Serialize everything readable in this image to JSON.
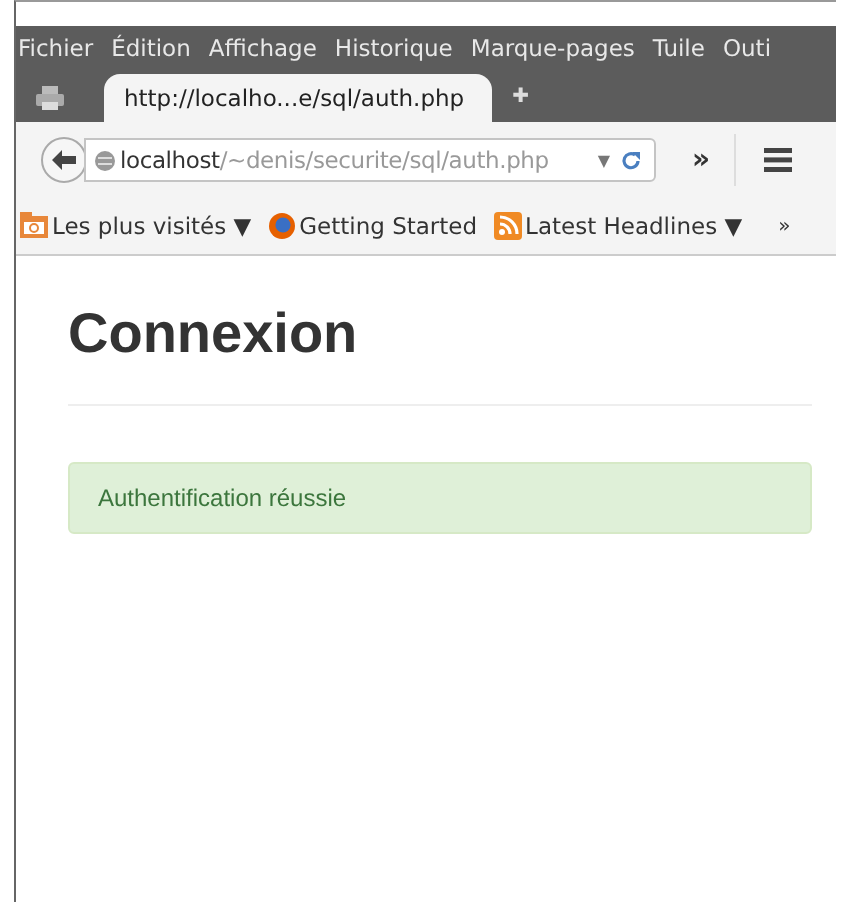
{
  "menu_bar": {
    "items": [
      "Fichier",
      "Édition",
      "Affichage",
      "Historique",
      "Marque-pages",
      "Tuile",
      "Outi"
    ]
  },
  "tabs": [
    {
      "label": "http://localho...e/sql/auth.php",
      "selected": true
    }
  ],
  "new_tab": "✚",
  "address_bar": {
    "url": "**localhost**/~denis/securite/sql/auth.php",
    "dropdown": "▼"
  },
  "toolbar_overflow": "»",
  "bookmarks": [
    {
      "kind": "folder",
      "label": "Les plus visités ▼"
    },
    {
      "kind": "browser",
      "label": "Getting Started"
    },
    {
      "kind": "feed",
      "label": "Latest Headlines ▼"
    }
  ],
  "bookmarks_overflow": "»",
  "page": {
    "heading": "Connexion",
    "alert": {
      "text": "Authentification réussie"
    }
  }
}
